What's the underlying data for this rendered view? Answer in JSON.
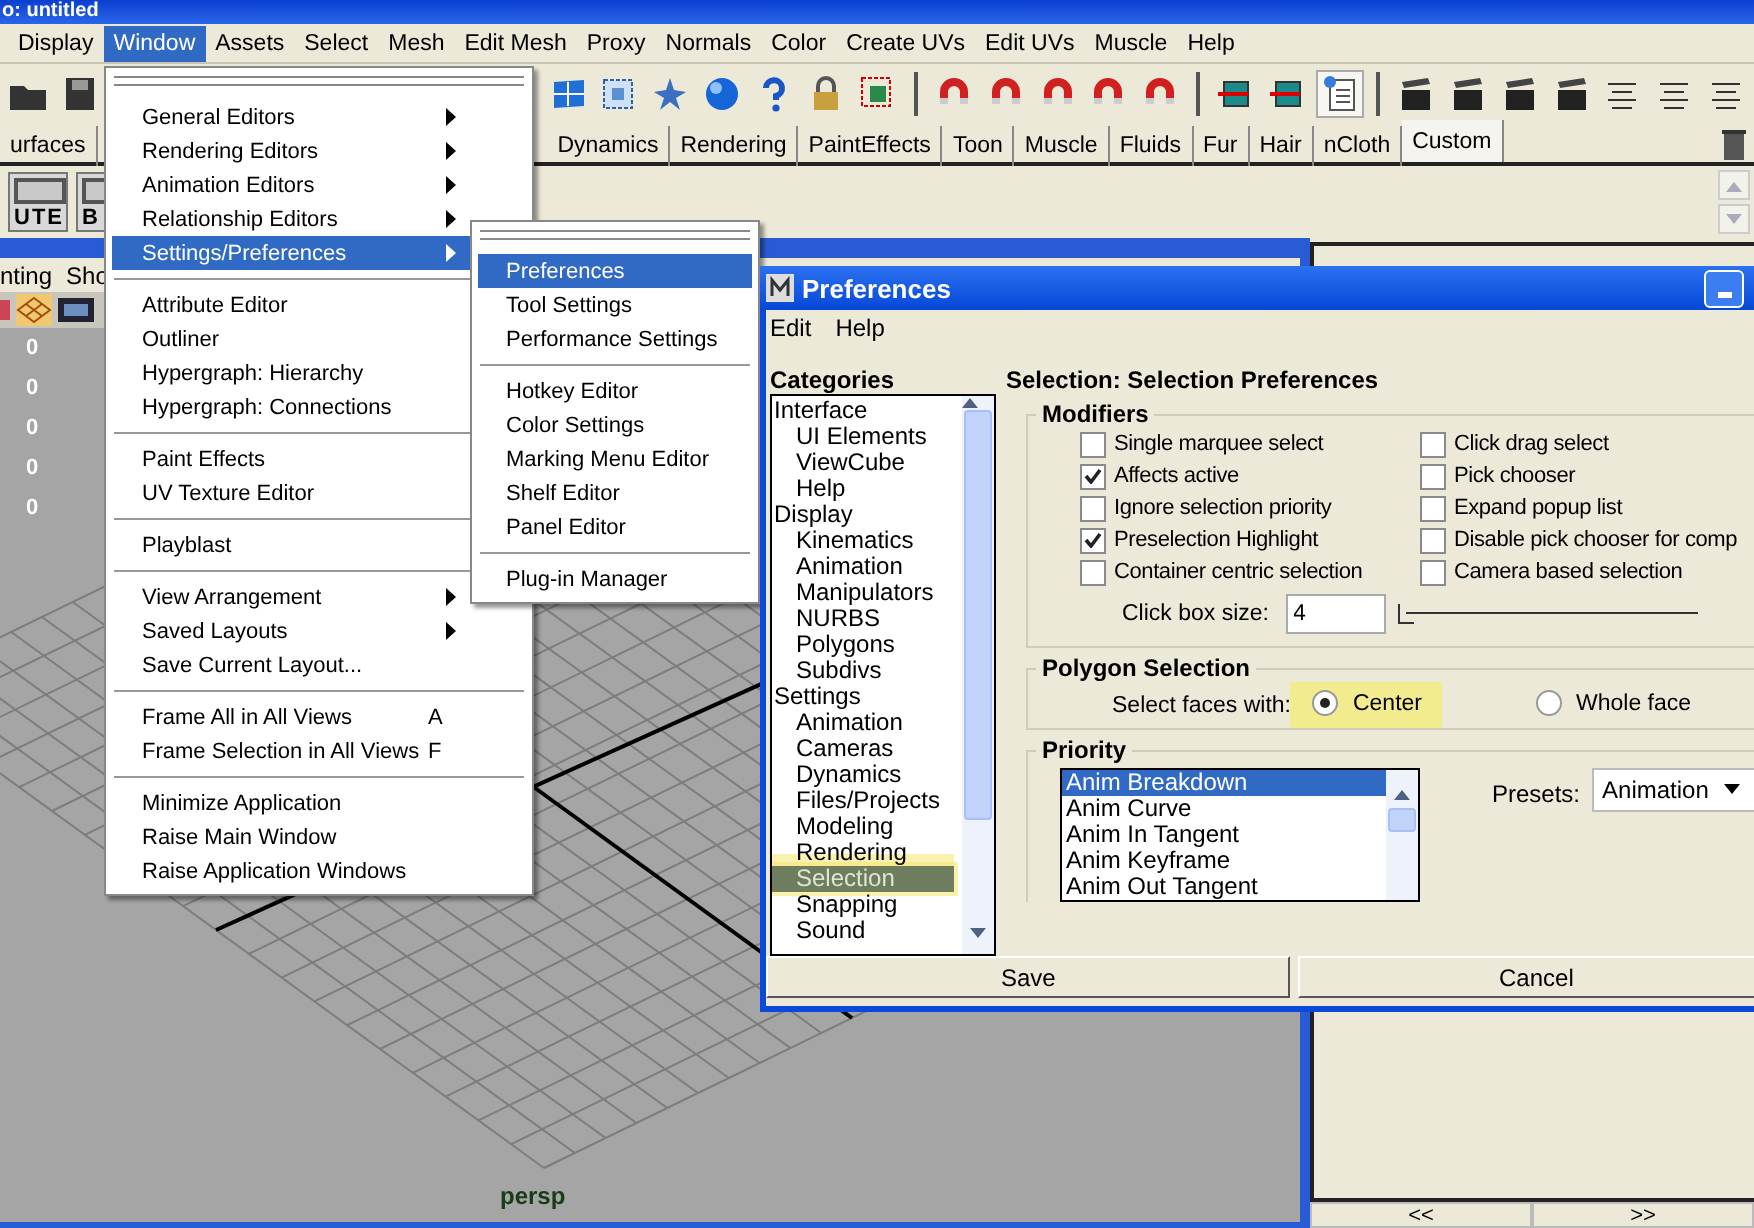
{
  "app_title": "o: untitled",
  "menubar": [
    {
      "label": "Display",
      "selected": false
    },
    {
      "label": "Window",
      "selected": true
    },
    {
      "label": "Assets",
      "selected": false
    },
    {
      "label": "Select",
      "selected": false
    },
    {
      "label": "Mesh",
      "selected": false
    },
    {
      "label": "Edit Mesh",
      "selected": false
    },
    {
      "label": "Proxy",
      "selected": false
    },
    {
      "label": "Normals",
      "selected": false
    },
    {
      "label": "Color",
      "selected": false
    },
    {
      "label": "Create UVs",
      "selected": false
    },
    {
      "label": "Edit UVs",
      "selected": false
    },
    {
      "label": "Muscle",
      "selected": false
    },
    {
      "label": "Help",
      "selected": false
    }
  ],
  "shelf_tabs": [
    {
      "label": "urfaces",
      "selected": false
    },
    {
      "label": "Dynamics",
      "selected": false
    },
    {
      "label": "Rendering",
      "selected": false
    },
    {
      "label": "PaintEffects",
      "selected": false
    },
    {
      "label": "Toon",
      "selected": false
    },
    {
      "label": "Muscle",
      "selected": false
    },
    {
      "label": "Fluids",
      "selected": false
    },
    {
      "label": "Fur",
      "selected": false
    },
    {
      "label": "Hair",
      "selected": false
    },
    {
      "label": "nCloth",
      "selected": false
    },
    {
      "label": "Custom",
      "selected": true
    }
  ],
  "shelf_buttons": [
    "UTE",
    "B"
  ],
  "panel_menu": [
    "nting",
    "Sho"
  ],
  "hud_values": [
    "0",
    "0",
    "0",
    "0",
    "0"
  ],
  "viewport_label": "persp",
  "window_menu": [
    {
      "kind": "item",
      "label": "General Editors",
      "submenu": true,
      "selected": false
    },
    {
      "kind": "item",
      "label": "Rendering Editors",
      "submenu": true,
      "selected": false
    },
    {
      "kind": "item",
      "label": "Animation Editors",
      "submenu": true,
      "selected": false
    },
    {
      "kind": "item",
      "label": "Relationship Editors",
      "submenu": true,
      "selected": false
    },
    {
      "kind": "item",
      "label": "Settings/Preferences",
      "submenu": true,
      "selected": true
    },
    {
      "kind": "separator"
    },
    {
      "kind": "item",
      "label": "Attribute Editor",
      "submenu": false,
      "selected": false
    },
    {
      "kind": "item",
      "label": "Outliner",
      "submenu": false,
      "selected": false
    },
    {
      "kind": "item",
      "label": "Hypergraph: Hierarchy",
      "submenu": false,
      "selected": false
    },
    {
      "kind": "item",
      "label": "Hypergraph: Connections",
      "submenu": false,
      "selected": false
    },
    {
      "kind": "separator"
    },
    {
      "kind": "item",
      "label": "Paint Effects",
      "submenu": false,
      "selected": false
    },
    {
      "kind": "item",
      "label": "UV Texture Editor",
      "submenu": false,
      "selected": false
    },
    {
      "kind": "separator"
    },
    {
      "kind": "item",
      "label": "Playblast",
      "submenu": false,
      "selected": false
    },
    {
      "kind": "separator"
    },
    {
      "kind": "item",
      "label": "View Arrangement",
      "submenu": true,
      "selected": false
    },
    {
      "kind": "item",
      "label": "Saved Layouts",
      "submenu": true,
      "selected": false
    },
    {
      "kind": "item",
      "label": "Save Current Layout...",
      "submenu": false,
      "selected": false
    },
    {
      "kind": "separator"
    },
    {
      "kind": "item",
      "label": "Frame All in All Views",
      "shortcut": "A",
      "submenu": false,
      "selected": false
    },
    {
      "kind": "item",
      "label": "Frame Selection in All Views",
      "shortcut": "F",
      "submenu": false,
      "selected": false
    },
    {
      "kind": "separator"
    },
    {
      "kind": "item",
      "label": "Minimize Application",
      "submenu": false,
      "selected": false
    },
    {
      "kind": "item",
      "label": "Raise Main Window",
      "submenu": false,
      "selected": false
    },
    {
      "kind": "item",
      "label": "Raise Application Windows",
      "submenu": false,
      "selected": false
    }
  ],
  "settings_submenu": [
    {
      "kind": "item",
      "label": "Preferences",
      "selected": true
    },
    {
      "kind": "item",
      "label": "Tool Settings",
      "selected": false
    },
    {
      "kind": "item",
      "label": "Performance Settings",
      "selected": false
    },
    {
      "kind": "separator"
    },
    {
      "kind": "item",
      "label": "Hotkey Editor",
      "selected": false
    },
    {
      "kind": "item",
      "label": "Color Settings",
      "selected": false
    },
    {
      "kind": "item",
      "label": "Marking Menu Editor",
      "selected": false
    },
    {
      "kind": "item",
      "label": "Shelf Editor",
      "selected": false
    },
    {
      "kind": "item",
      "label": "Panel Editor",
      "selected": false
    },
    {
      "kind": "separator"
    },
    {
      "kind": "item",
      "label": "Plug-in Manager",
      "selected": false
    }
  ],
  "preferences": {
    "title": "Preferences",
    "menu": [
      "Edit",
      "Help"
    ],
    "categories_label": "Categories",
    "categories": [
      {
        "label": "Interface",
        "selected": false,
        "children": [
          {
            "label": "UI Elements",
            "selected": false
          },
          {
            "label": "ViewCube",
            "selected": false
          },
          {
            "label": "Help",
            "selected": false
          }
        ]
      },
      {
        "label": "Display",
        "selected": false,
        "children": [
          {
            "label": "Kinematics",
            "selected": false
          },
          {
            "label": "Animation",
            "selected": false
          },
          {
            "label": "Manipulators",
            "selected": false
          },
          {
            "label": "NURBS",
            "selected": false
          },
          {
            "label": "Polygons",
            "selected": false
          },
          {
            "label": "Subdivs",
            "selected": false
          }
        ]
      },
      {
        "label": "Settings",
        "selected": false,
        "children": [
          {
            "label": "Animation",
            "selected": false
          },
          {
            "label": "Cameras",
            "selected": false
          },
          {
            "label": "Dynamics",
            "selected": false
          },
          {
            "label": "Files/Projects",
            "selected": false
          },
          {
            "label": "Modeling",
            "selected": false
          },
          {
            "label": "Rendering",
            "selected": false
          },
          {
            "label": "Selection",
            "selected": true
          },
          {
            "label": "Snapping",
            "selected": false
          },
          {
            "label": "Sound",
            "selected": false
          }
        ]
      }
    ],
    "heading": "Selection: Selection Preferences",
    "modifiers": {
      "title": "Modifiers",
      "options": [
        {
          "label": "Single marquee select",
          "checked": false
        },
        {
          "label": "Affects active",
          "checked": true
        },
        {
          "label": "Ignore selection priority",
          "checked": false
        },
        {
          "label": "Preselection Highlight",
          "checked": true
        },
        {
          "label": "Container centric selection",
          "checked": false
        },
        {
          "label": "Click drag select",
          "checked": false
        },
        {
          "label": "Pick chooser",
          "checked": false
        },
        {
          "label": "Expand popup list",
          "checked": false
        },
        {
          "label": "Disable pick chooser for comp",
          "checked": false
        },
        {
          "label": "Camera based selection",
          "checked": false
        }
      ],
      "click_box": {
        "label": "Click box size:",
        "value": "4",
        "level": 0
      }
    },
    "polygon_selection": {
      "title": "Polygon Selection",
      "label": "Select faces with:",
      "options": [
        {
          "label": "Center",
          "selected": true,
          "highlighted": true
        },
        {
          "label": "Whole face",
          "selected": false,
          "highlighted": false
        }
      ]
    },
    "priority": {
      "title": "Priority",
      "items": [
        {
          "label": "Anim Breakdown",
          "selected": true
        },
        {
          "label": "Anim Curve",
          "selected": false
        },
        {
          "label": "Anim In Tangent",
          "selected": false
        },
        {
          "label": "Anim Keyframe",
          "selected": false
        },
        {
          "label": "Anim Out Tangent",
          "selected": false
        }
      ],
      "presets_label": "Presets:",
      "presets_value": "Animation"
    },
    "buttons": [
      "Save",
      "Cancel"
    ]
  },
  "side_panel": {
    "buttons": [
      "<<",
      ">>"
    ]
  }
}
